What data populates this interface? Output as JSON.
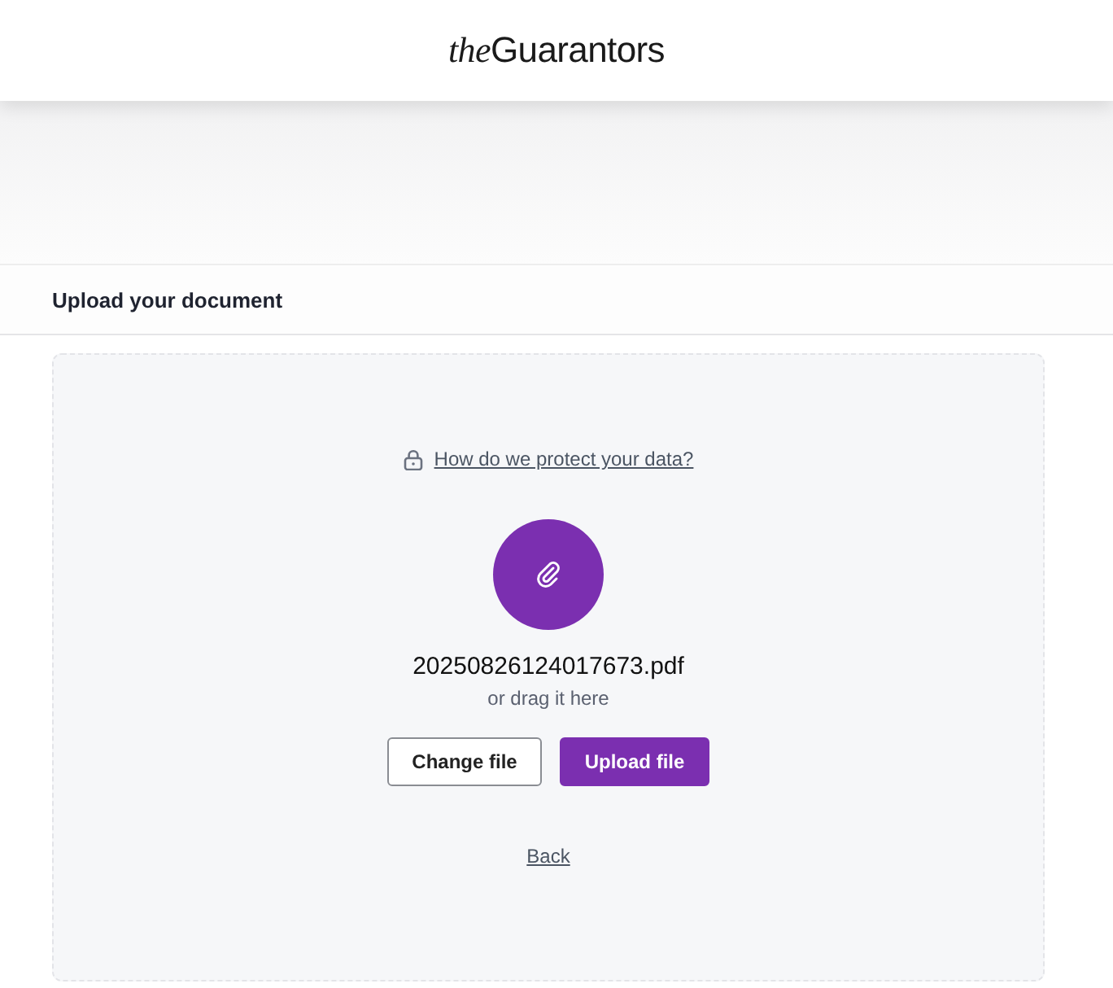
{
  "header": {
    "logo_prefix": "the",
    "logo_name": "Guarantors"
  },
  "section": {
    "title": "Upload your document"
  },
  "upload": {
    "protect_link": "How do we protect your data?",
    "file_name": "20250826124017673.pdf",
    "hint": "or drag it here",
    "buttons": [
      {
        "label": "Change file",
        "kind": "secondary"
      },
      {
        "label": "Upload file",
        "kind": "primary"
      }
    ],
    "back_link": "Back"
  }
}
